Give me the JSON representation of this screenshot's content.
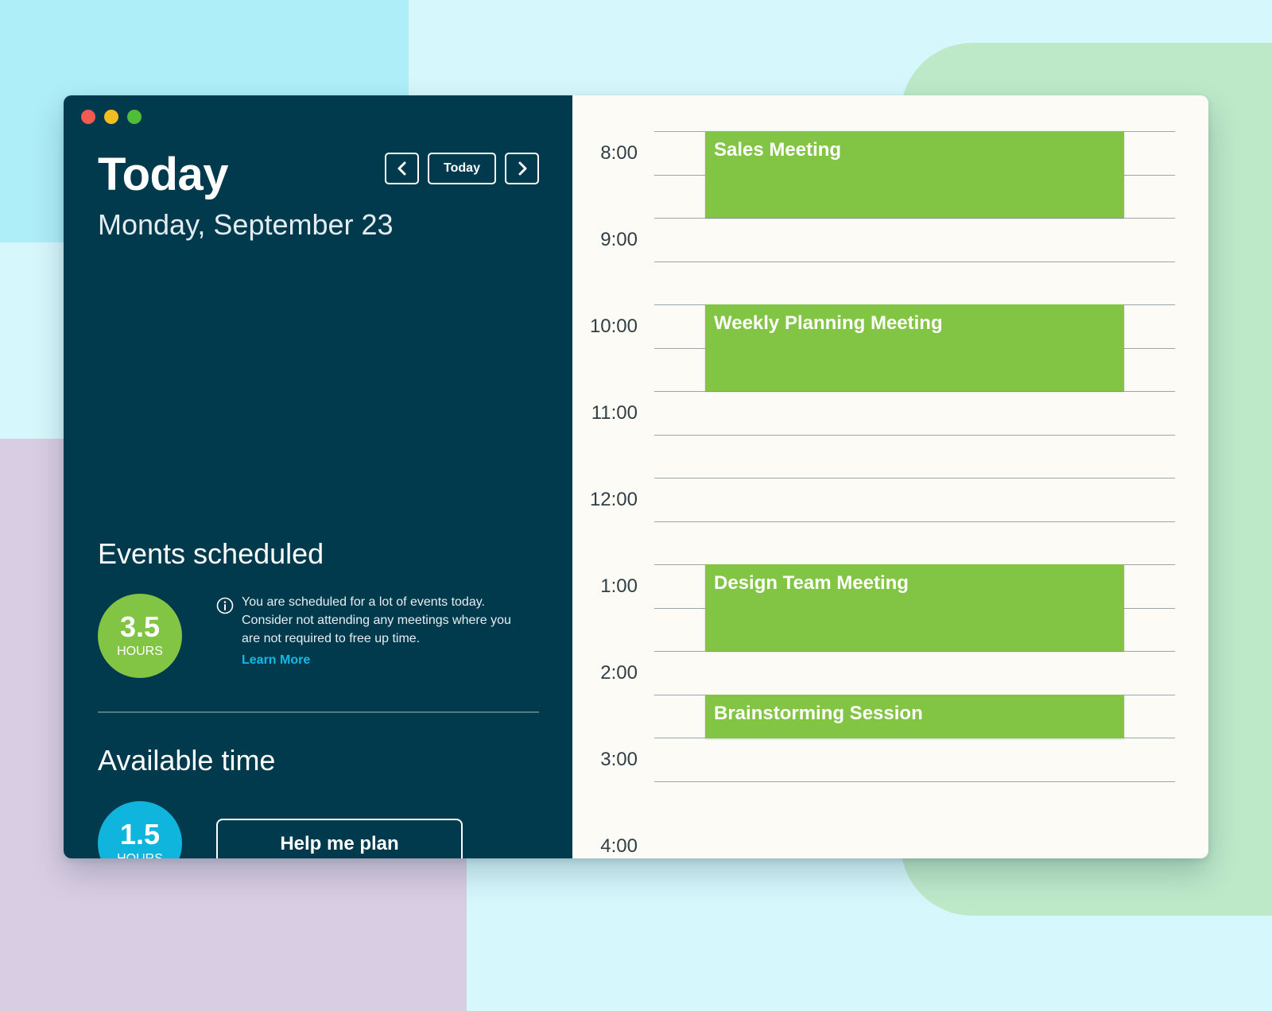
{
  "header": {
    "title": "Today",
    "date": "Monday, September 23",
    "nav": {
      "prev_icon": "chevron-left-icon",
      "today_label": "Today",
      "next_icon": "chevron-right-icon"
    }
  },
  "events_scheduled": {
    "heading": "Events scheduled",
    "hours_value": "3.5",
    "hours_unit": "HOURS",
    "info_icon": "info-icon",
    "info_text": "You are scheduled for a lot of events today. Consider not attending any meetings where you are not required to free up time.",
    "learn_more": "Learn More"
  },
  "available_time": {
    "heading": "Available time",
    "hours_value": "1.5",
    "hours_unit": "HOURS",
    "help_button": "Help me plan"
  },
  "calendar": {
    "times": [
      "8:00",
      "9:00",
      "10:00",
      "11:00",
      "12:00",
      "1:00",
      "2:00",
      "3:00",
      "4:00"
    ],
    "events": [
      {
        "title": "Sales Meeting",
        "start": "8:00",
        "end": "9:00"
      },
      {
        "title": "Weekly Planning Meeting",
        "start": "10:00",
        "end": "11:00"
      },
      {
        "title": "Design Team Meeting",
        "start": "1:00",
        "end": "2:00"
      },
      {
        "title": "Brainstorming Session",
        "start": "2:30",
        "end": "3:00"
      }
    ]
  },
  "colors": {
    "sidebar_bg": "#023a4d",
    "calendar_bg": "#fdfbf6",
    "event_green": "#82c443",
    "available_blue": "#0fb5dc",
    "link_blue": "#14b9e6"
  }
}
